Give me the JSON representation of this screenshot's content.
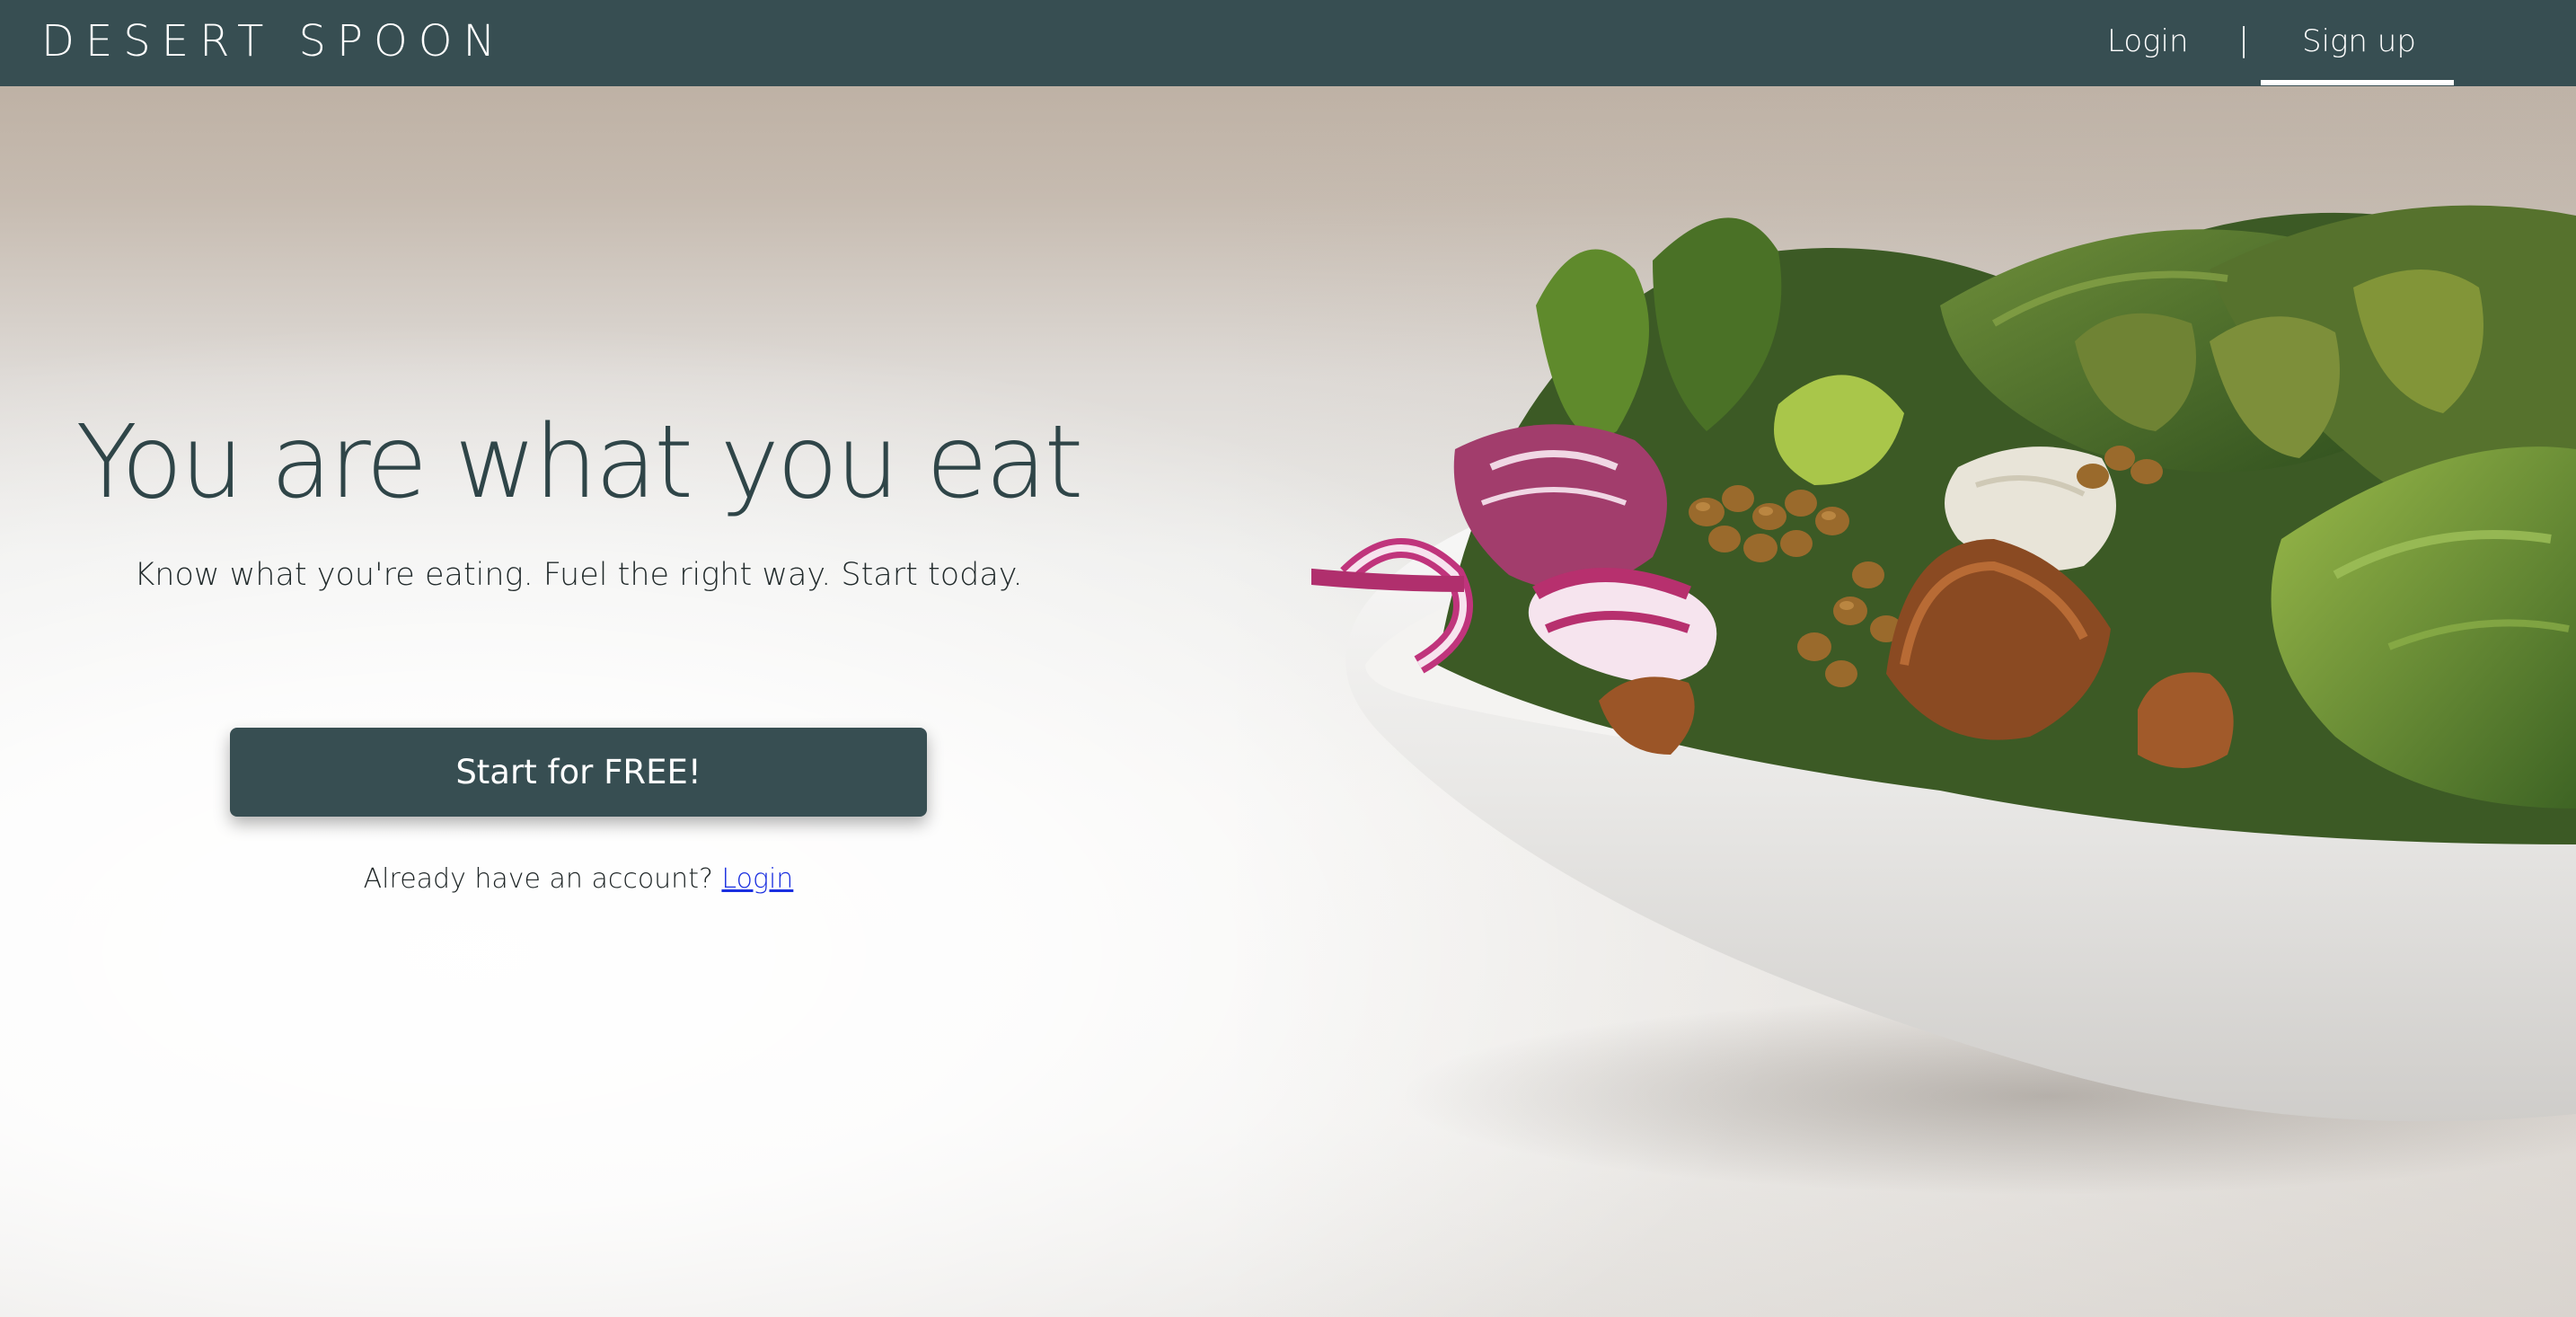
{
  "navbar": {
    "brand": "DESERT SPOON",
    "login_label": "Login",
    "separator": "|",
    "signup_label": "Sign up",
    "active_item": "Sign up",
    "background_color": "#374e52"
  },
  "hero": {
    "headline": "You are what you eat",
    "subheadline": "Know what you're eating. Fuel the right way. Start today.",
    "cta_label": "Start for FREE!",
    "account_prompt": "Already have an account?",
    "account_link_label": "Login",
    "headline_color": "#2f4548",
    "link_color": "#1a2fe0",
    "background_image": "salad-bowl-photo"
  }
}
